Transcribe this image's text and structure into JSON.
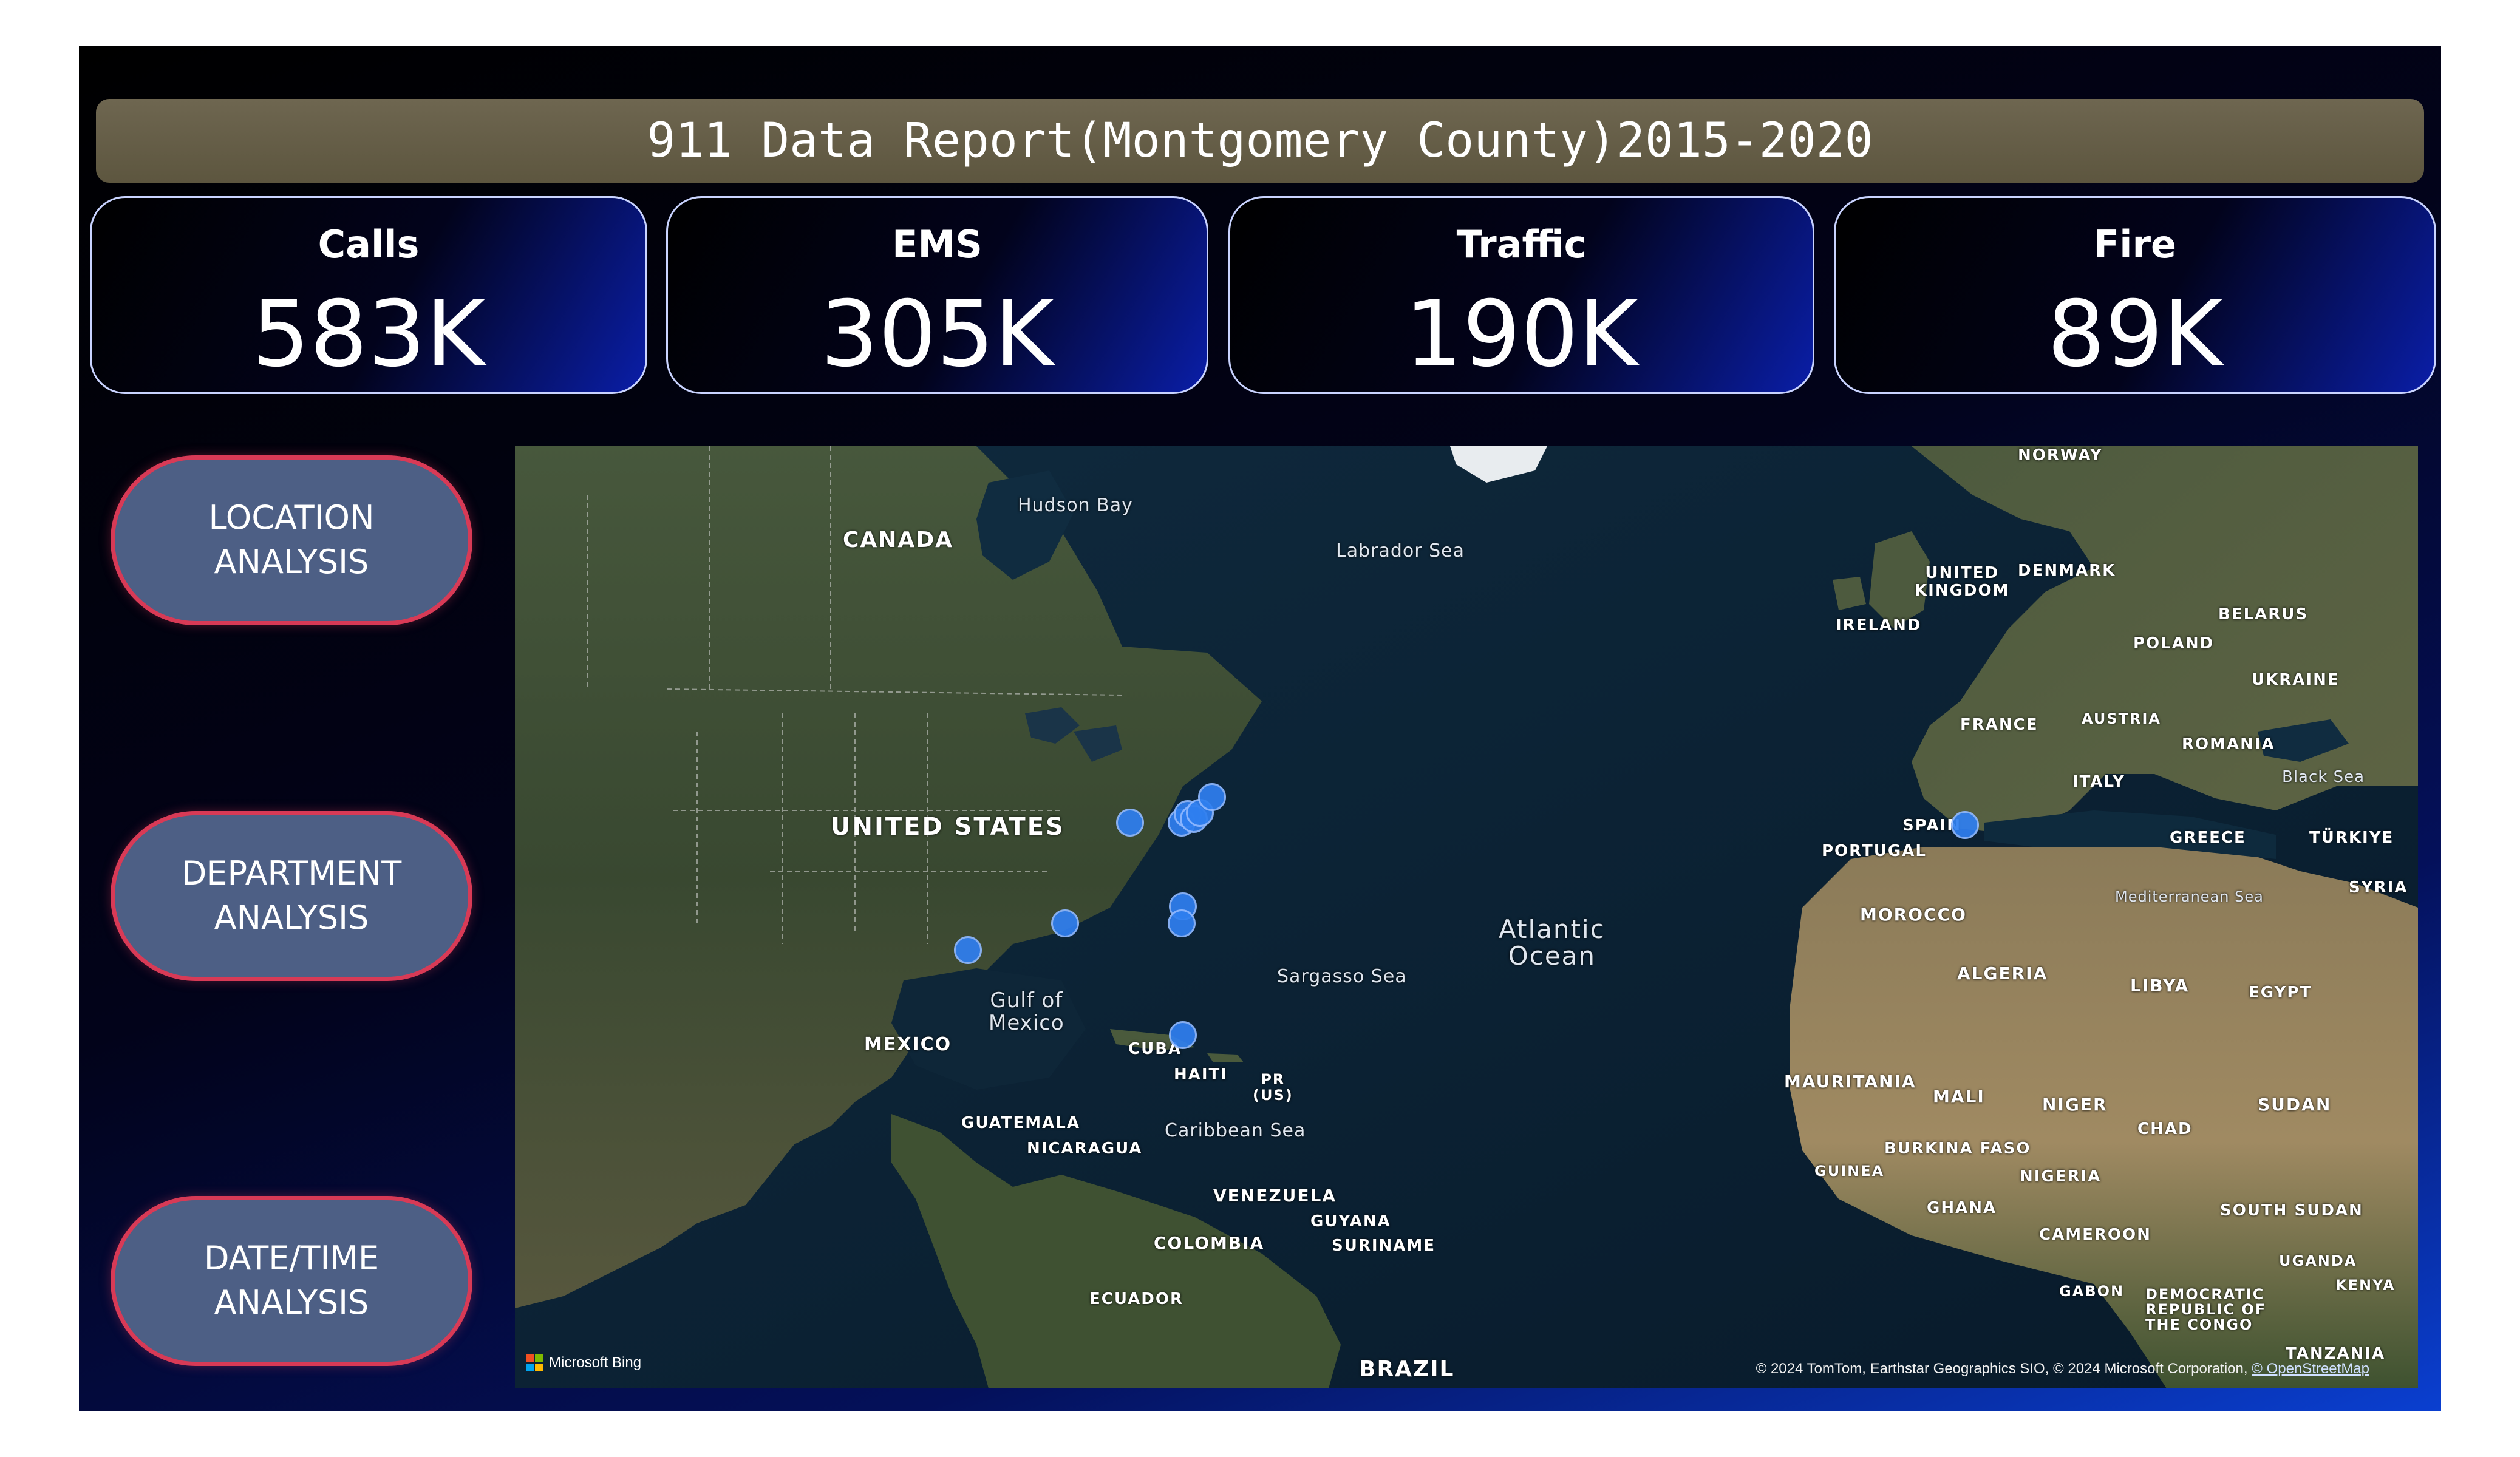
{
  "title": "911 Data Report(Montgomery County)2015-2020",
  "kpis": [
    {
      "label": "Calls",
      "value": "583K"
    },
    {
      "label": "EMS",
      "value": "305K"
    },
    {
      "label": "Traffic",
      "value": "190K"
    },
    {
      "label": "Fire",
      "value": "89K"
    }
  ],
  "nav_buttons": [
    {
      "line1": "LOCATION",
      "line2": "ANALYSIS"
    },
    {
      "line1": "DEPARTMENT",
      "line2": "ANALYSIS"
    },
    {
      "line1": "DATE/TIME",
      "line2": "ANALYSIS"
    }
  ],
  "map": {
    "labels": {
      "canada": "CANADA",
      "hudson_bay": "Hudson Bay",
      "labrador_sea": "Labrador Sea",
      "united_states": "UNITED STATES",
      "gulf_line1": "Gulf of",
      "gulf_line2": "Mexico",
      "mexico": "MEXICO",
      "cuba": "CUBA",
      "haiti": "HAITI",
      "pr_line1": "PR",
      "pr_line2": "(US)",
      "guatemala": "GUATEMALA",
      "nicaragua": "NICARAGUA",
      "caribbean_sea": "Caribbean Sea",
      "sargasso_sea": "Sargasso Sea",
      "atlantic_line1": "Atlantic",
      "atlantic_line2": "Ocean",
      "venezuela": "VENEZUELA",
      "guyana": "GUYANA",
      "suriname": "SURINAME",
      "colombia": "COLOMBIA",
      "ecuador": "ECUADOR",
      "brazil": "BRAZIL",
      "norway": "NORWAY",
      "united_kingdom_line1": "UNITED",
      "united_kingdom_line2": "KINGDOM",
      "denmark": "DENMARK",
      "ireland": "IRELAND",
      "belarus": "BELARUS",
      "poland": "POLAND",
      "ukraine": "UKRAINE",
      "france": "FRANCE",
      "austria": "AUSTRIA",
      "romania": "ROMANIA",
      "black_sea": "Black Sea",
      "italy": "ITALY",
      "spain": "SPAIN",
      "portugal": "PORTUGAL",
      "greece": "GREECE",
      "turkiye": "TÜRKIYE",
      "syria": "SYRIA",
      "mediterranean_sea": "Mediterranean Sea",
      "morocco": "MOROCCO",
      "algeria": "ALGERIA",
      "libya": "LIBYA",
      "egypt": "EGYPT",
      "mauritania": "MAURITANIA",
      "mali": "MALI",
      "niger": "NIGER",
      "chad": "CHAD",
      "sudan": "SUDAN",
      "burkina_faso": "BURKINA FASO",
      "guinea": "GUINEA",
      "nigeria": "NIGERIA",
      "ghana": "GHANA",
      "south_sudan": "SOUTH SUDAN",
      "cameroon": "CAMEROON",
      "uganda": "UGANDA",
      "kenya": "KENYA",
      "gabon": "GABON",
      "drc_line1": "DEMOCRATIC",
      "drc_line2": "REPUBLIC OF",
      "drc_line3": "THE CONGO",
      "tanzania": "TANZANIA"
    },
    "provider": "Microsoft Bing",
    "attribution_text": "© 2024 TomTom, Earthstar Geographics SIO, © 2024 Microsoft Corporation, ",
    "attribution_link": "© OpenStreetMap"
  },
  "colors": {
    "title_bar": "#6e6650",
    "button_fill": "#4d5f85",
    "button_border": "#d83a56",
    "dot": "#2f7ff0"
  }
}
